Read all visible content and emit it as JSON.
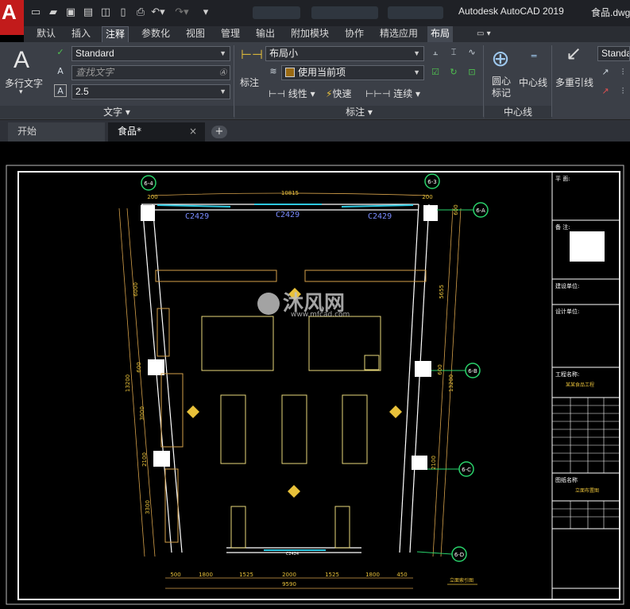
{
  "app": {
    "logo": "A",
    "title": "Autodesk AutoCAD 2019",
    "file": "食品.dwg"
  },
  "qat": [
    "new-icon",
    "open-icon",
    "save-icon",
    "save-as-icon",
    "plot-preview-icon",
    "publish-icon",
    "print-icon",
    "undo-icon",
    "redo-icon",
    "customize-icon"
  ],
  "ribbon_tabs": [
    {
      "label": "默认"
    },
    {
      "label": "插入"
    },
    {
      "label": "注释"
    },
    {
      "label": "参数化"
    },
    {
      "label": "视图"
    },
    {
      "label": "管理"
    },
    {
      "label": "输出"
    },
    {
      "label": "附加模块"
    },
    {
      "label": "协作"
    },
    {
      "label": "精选应用"
    },
    {
      "label": "布局"
    }
  ],
  "ribbon": {
    "text_panel": {
      "big_button": "多行文字",
      "style": "Standard",
      "search_placeholder": "查找文字",
      "height": "2.5",
      "label": "文字 ▾"
    },
    "dim_panel": {
      "big_button": "标注",
      "dim_style": "布局小",
      "layer": "使用当前项",
      "linear": "线性",
      "quick": "快速",
      "continue": "连续",
      "label": "标注 ▾"
    },
    "centerline_panel": {
      "center_mark": "圆心\n标记",
      "center_mark_l1": "圆心",
      "center_mark_l2": "标记",
      "centerline": "中心线",
      "label": "中心线"
    },
    "leader_panel": {
      "multileader": "多重引线",
      "style": "Standa"
    }
  },
  "doc_tabs": {
    "start": "开始",
    "current": "食品*",
    "close": "×",
    "add": "+"
  },
  "drawing": {
    "axis_tags": [
      "6-4",
      "6-3",
      "6-A",
      "6-B",
      "6-C",
      "6-D"
    ],
    "window_labels": [
      "C2429",
      "C2429",
      "C2429"
    ],
    "top_dims": [
      "200",
      "10815",
      "200",
      "600"
    ],
    "right_dims": [
      "5655",
      "600",
      "13200",
      "2100"
    ],
    "left_dims": [
      "6000",
      "600",
      "13200",
      "3000",
      "2100",
      "3300"
    ],
    "bottom_dims": [
      "500",
      "1800",
      "1525",
      "2000",
      "1525",
      "1800",
      "450"
    ],
    "total_width": "9590",
    "door_label": "C2424",
    "watermark_main": "沐风网",
    "watermark_url": "www.mfcad.com",
    "title_block": {
      "plan": "平 面:",
      "note": "备 注:",
      "client": "建设单位:",
      "designer": "设计单位:",
      "project": "工程名称:",
      "project_value": "某某食品工程",
      "drawing_name": "图纸名称",
      "drawing_value": "立面布置图"
    },
    "sheet_caption": "立面索引图"
  }
}
